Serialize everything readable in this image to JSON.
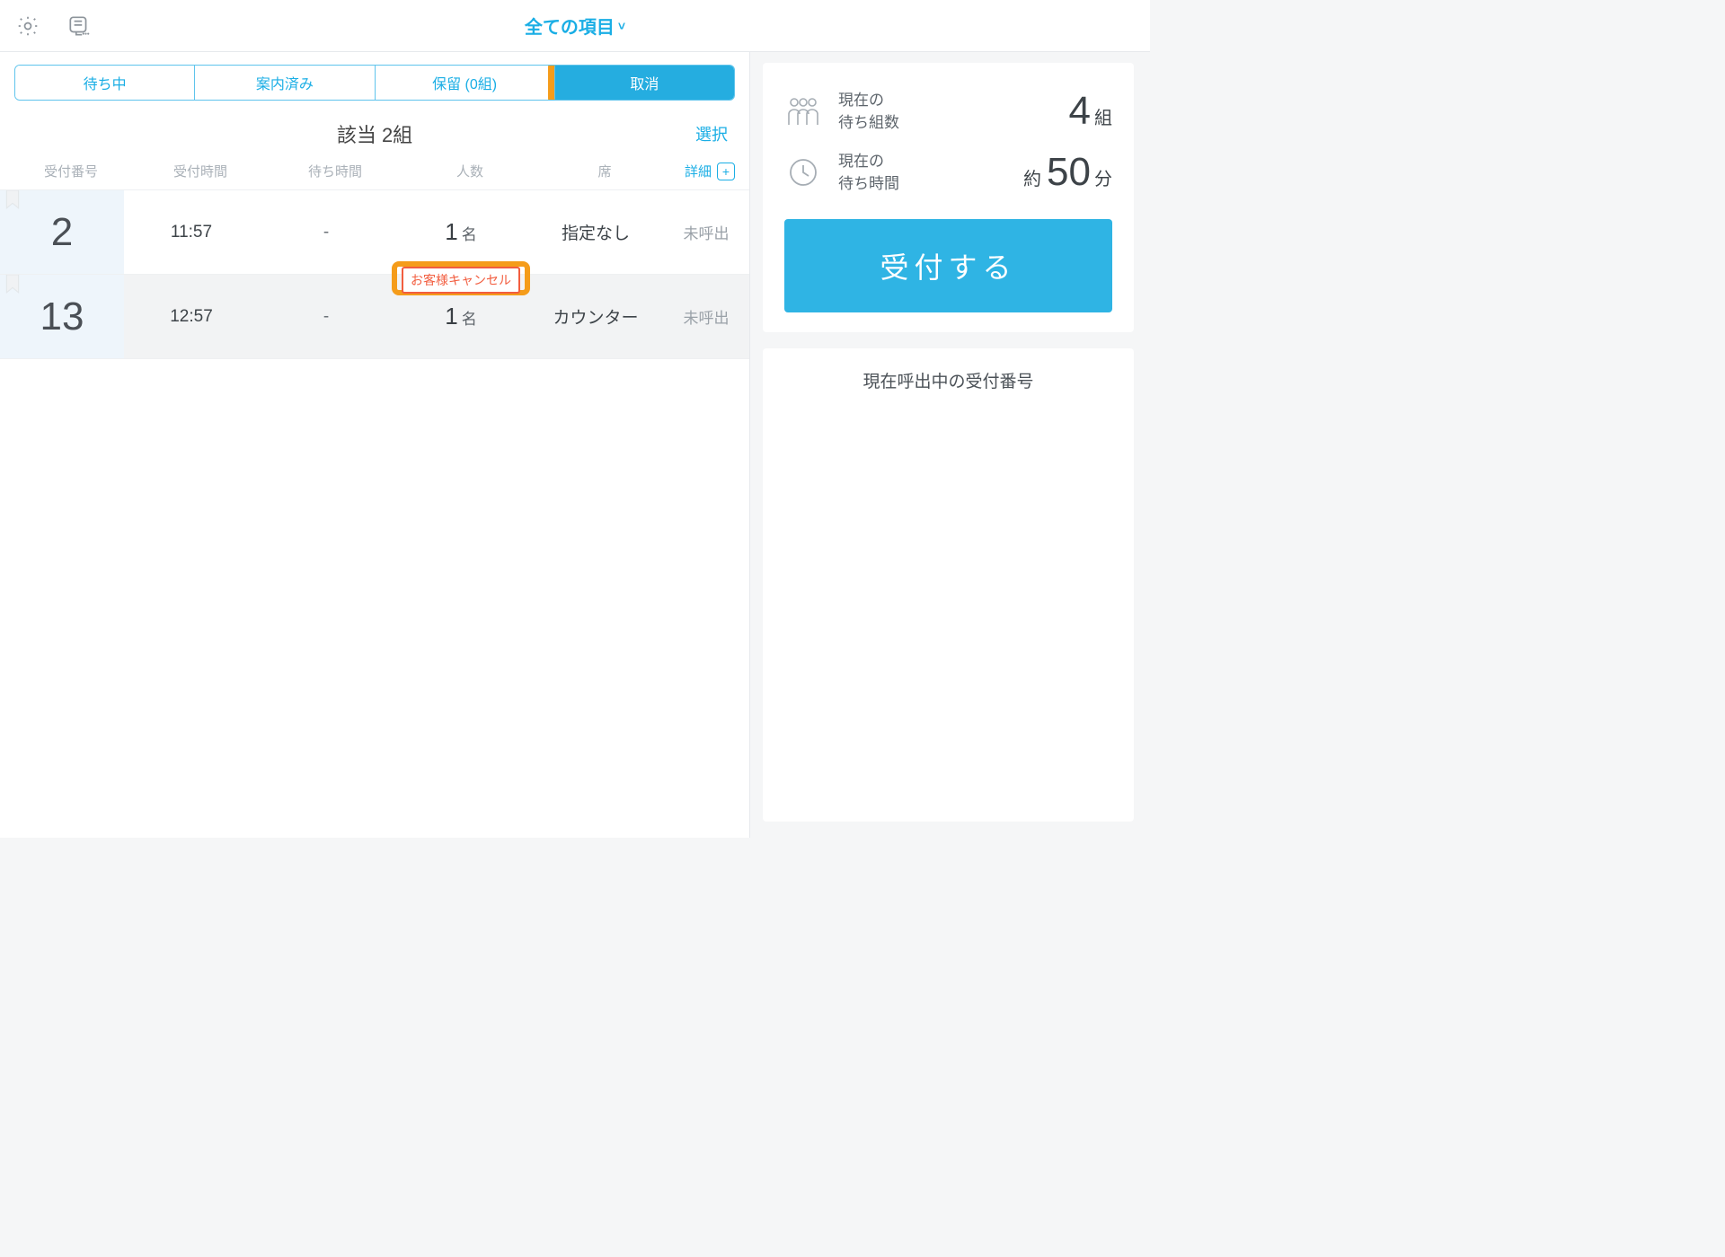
{
  "header": {
    "dropdown_label": "全ての項目"
  },
  "tabs": {
    "waiting": "待ち中",
    "guided": "案内済み",
    "hold": "保留 (0組)",
    "cancel": "取消"
  },
  "summary": {
    "label_prefix": "該当 ",
    "count_text": "2組",
    "select_label": "選択"
  },
  "columns": {
    "ticket_no": "受付番号",
    "ticket_time": "受付時間",
    "wait_time": "待ち時間",
    "people": "人数",
    "seat": "席",
    "detail": "詳細"
  },
  "rows": [
    {
      "ticket_no": "2",
      "time": "11:57",
      "wait": "-",
      "people_num": "1",
      "people_unit": "名",
      "seat": "指定なし",
      "status": "未呼出",
      "cancel_label": ""
    },
    {
      "ticket_no": "13",
      "time": "12:57",
      "wait": "-",
      "people_num": "1",
      "people_unit": "名",
      "seat": "カウンター",
      "status": "未呼出",
      "cancel_label": "お客様キャンセル"
    }
  ],
  "side": {
    "groups_label_line1": "現在の",
    "groups_label_line2": "待ち組数",
    "groups_value": "4",
    "groups_unit": "組",
    "wait_label_line1": "現在の",
    "wait_label_line2": "待ち時間",
    "wait_prefix": "約",
    "wait_value": "50",
    "wait_unit": "分",
    "accept_label": "受付する",
    "calling_title": "現在呼出中の受付番号"
  }
}
